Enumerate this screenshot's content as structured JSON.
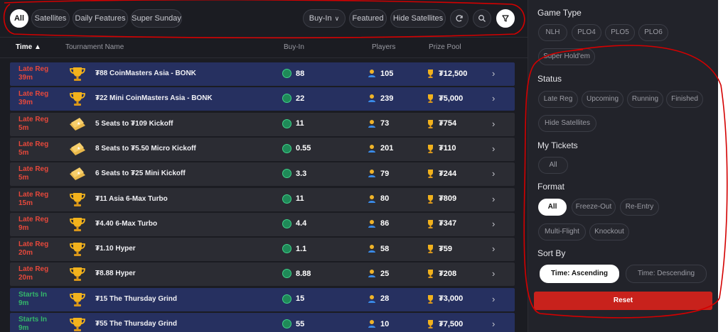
{
  "filters": {
    "tabs": [
      {
        "label": "All",
        "active": true
      },
      {
        "label": "Satellites",
        "active": false
      },
      {
        "label": "Daily Features",
        "active": false
      },
      {
        "label": "Super Sunday",
        "active": false
      }
    ],
    "buyin_label": "Buy-In",
    "featured_label": "Featured",
    "hide_satellites_label": "Hide Satellites",
    "icons": [
      "refresh-icon",
      "search-icon",
      "filter-icon"
    ]
  },
  "table": {
    "headers": {
      "time": "Time ▲",
      "name": "Tournament Name",
      "buyin": "Buy-In",
      "players": "Players",
      "prize": "Prize Pool"
    },
    "rows": [
      {
        "status": "Late Reg",
        "time": "39m",
        "status_color": "red",
        "icon": "trophy-icon",
        "name": "₮88 CoinMasters Asia - BONK",
        "buyin": "88",
        "players": "105",
        "prize": "₮12,500",
        "highlight": "blue"
      },
      {
        "status": "Late Reg",
        "time": "39m",
        "status_color": "red",
        "icon": "trophy-icon",
        "name": "₮22 Mini CoinMasters Asia - BONK",
        "buyin": "22",
        "players": "239",
        "prize": "₮5,000",
        "highlight": "blue"
      },
      {
        "status": "Late Reg",
        "time": "5m",
        "status_color": "red",
        "icon": "ticket-icon",
        "name": "5 Seats to ₮109 Kickoff",
        "buyin": "11",
        "players": "73",
        "prize": "₮754",
        "highlight": "grey"
      },
      {
        "status": "Late Reg",
        "time": "5m",
        "status_color": "red",
        "icon": "ticket-icon",
        "name": "8 Seats to ₮5.50 Micro Kickoff",
        "buyin": "0.55",
        "players": "201",
        "prize": "₮110",
        "highlight": "grey"
      },
      {
        "status": "Late Reg",
        "time": "5m",
        "status_color": "red",
        "icon": "ticket-icon",
        "name": "6 Seats to ₮25 Mini Kickoff",
        "buyin": "3.3",
        "players": "79",
        "prize": "₮244",
        "highlight": "grey"
      },
      {
        "status": "Late Reg",
        "time": "15m",
        "status_color": "red",
        "icon": "trophy-icon",
        "name": "₮11 Asia 6-Max Turbo",
        "buyin": "11",
        "players": "80",
        "prize": "₮809",
        "highlight": "grey"
      },
      {
        "status": "Late Reg",
        "time": "9m",
        "status_color": "red",
        "icon": "trophy-icon",
        "name": "₮4.40 6-Max Turbo",
        "buyin": "4.4",
        "players": "86",
        "prize": "₮347",
        "highlight": "grey"
      },
      {
        "status": "Late Reg",
        "time": "20m",
        "status_color": "red",
        "icon": "trophy-icon",
        "name": "₮1.10 Hyper",
        "buyin": "1.1",
        "players": "58",
        "prize": "₮59",
        "highlight": "grey"
      },
      {
        "status": "Late Reg",
        "time": "20m",
        "status_color": "red",
        "icon": "trophy-icon",
        "name": "₮8.88 Hyper",
        "buyin": "8.88",
        "players": "25",
        "prize": "₮208",
        "highlight": "grey"
      },
      {
        "status": "Starts In",
        "time": "9m",
        "status_color": "green",
        "icon": "trophy-icon",
        "name": "₮15 The Thursday Grind",
        "buyin": "15",
        "players": "28",
        "prize": "₮3,000",
        "highlight": "blue"
      },
      {
        "status": "Starts In",
        "time": "9m",
        "status_color": "green",
        "icon": "trophy-icon",
        "name": "₮55 The Thursday Grind",
        "buyin": "55",
        "players": "10",
        "prize": "₮7,500",
        "highlight": "blue"
      }
    ]
  },
  "panel": {
    "game_type": {
      "title": "Game Type",
      "options": [
        "NLH",
        "PLO4",
        "PLO5",
        "PLO6",
        "Super Hold'em"
      ]
    },
    "status": {
      "title": "Status",
      "options": [
        "Late Reg",
        "Upcoming",
        "Running",
        "Finished",
        "Hide Satellites"
      ]
    },
    "my_tickets": {
      "title": "My Tickets",
      "options": [
        "All"
      ]
    },
    "format": {
      "title": "Format",
      "options": [
        "All",
        "Freeze-Out",
        "Re-Entry",
        "Multi-Flight",
        "Knockout"
      ],
      "selected": "All"
    },
    "sort_by": {
      "title": "Sort By",
      "options": [
        "Time: Ascending",
        "Time: Descending"
      ],
      "selected": "Time: Ascending"
    },
    "reset_label": "Reset"
  },
  "colors": {
    "accent_red": "#c8221c",
    "late_reg": "#e5483b",
    "starts_in": "#34b56a",
    "annotation": "#d40000"
  }
}
